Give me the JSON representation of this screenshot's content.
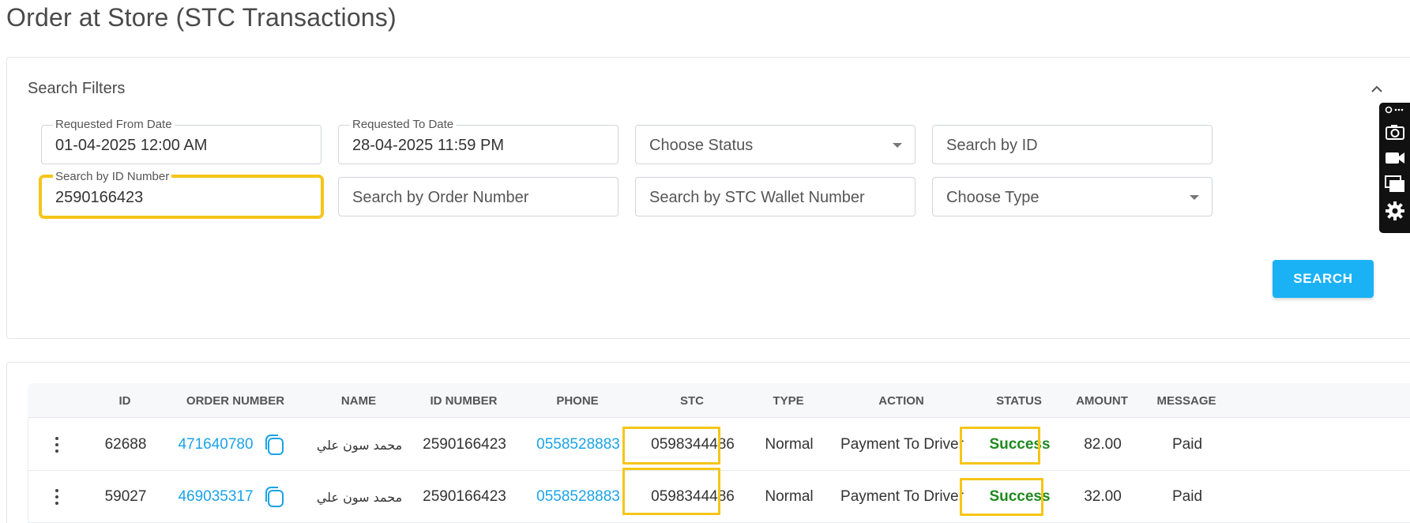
{
  "page": {
    "title": "Order at Store (STC Transactions)"
  },
  "filters": {
    "title": "Search Filters",
    "from_date": {
      "label": "Requested From Date",
      "value": "01-04-2025 12:00 AM"
    },
    "to_date": {
      "label": "Requested To Date",
      "value": "28-04-2025 11:59 PM"
    },
    "status": {
      "placeholder": "Choose Status"
    },
    "search_id": {
      "placeholder": "Search by ID"
    },
    "id_number": {
      "label": "Search by ID Number",
      "value": "2590166423"
    },
    "order_number": {
      "placeholder": "Search by Order Number"
    },
    "wallet_number": {
      "placeholder": "Search by STC Wallet Number"
    },
    "type": {
      "placeholder": "Choose Type"
    },
    "search_button": "SEARCH"
  },
  "table": {
    "columns": [
      "ID",
      "ORDER NUMBER",
      "NAME",
      "ID NUMBER",
      "PHONE",
      "STC",
      "TYPE",
      "ACTION",
      "STATUS",
      "AMOUNT",
      "MESSAGE"
    ],
    "rows": [
      {
        "id": "62688",
        "order_number": "471640780",
        "name": "محمد سون علي",
        "id_number": "2590166423",
        "phone": "0558528883",
        "stc": "0598344486",
        "type": "Normal",
        "action": "Payment To Driver",
        "status": "Success",
        "amount": "82.00",
        "message": "Paid"
      },
      {
        "id": "59027",
        "order_number": "469035317",
        "name": "محمد سون علي",
        "id_number": "2590166423",
        "phone": "0558528883",
        "stc": "0598344486",
        "type": "Normal",
        "action": "Payment To Driver",
        "status": "Success",
        "amount": "32.00",
        "message": "Paid"
      }
    ]
  },
  "colors": {
    "accent": "#1ab2f5",
    "link": "#1aa3e8",
    "success": "#1e8a1e",
    "highlight": "#f5c518"
  },
  "icons": [
    "chevron-up-icon",
    "caret-down-icon",
    "camera-icon",
    "video-icon",
    "screens-icon",
    "gear-icon",
    "kebab-menu-icon",
    "copy-icon",
    "extension-icon"
  ]
}
